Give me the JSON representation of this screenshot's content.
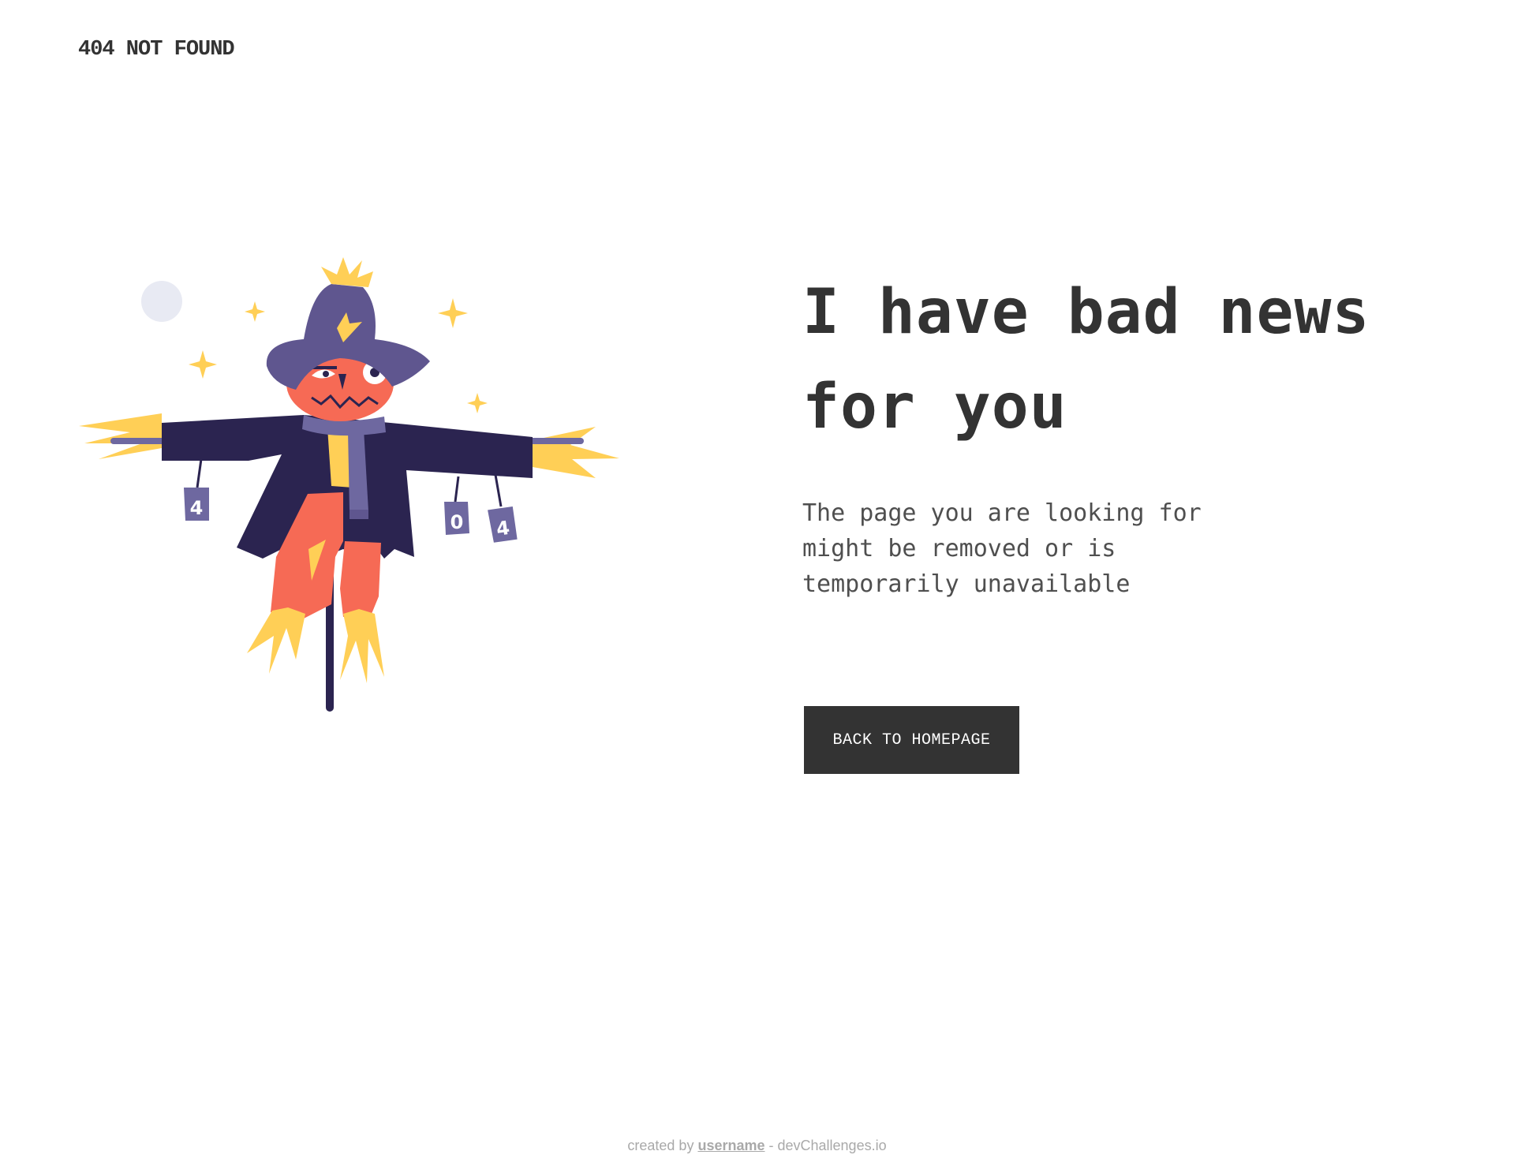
{
  "header": {
    "brand": "404 NOT FOUND"
  },
  "illustration": {
    "can_labels": [
      "4",
      "0",
      "4"
    ]
  },
  "main": {
    "headline_line1": "I have bad news",
    "headline_line2": "for you",
    "description_line1": "The page you are looking for",
    "description_line2": "might be removed or is",
    "description_line3": "temporarily unavailable",
    "cta_label": "BACK TO HOMEPAGE"
  },
  "footer": {
    "prefix": "created by ",
    "username": "username",
    "suffix": " - devChallenges.io"
  },
  "colors": {
    "text_dark": "#333333",
    "text_body": "#4F4F4F",
    "button_bg": "#333333",
    "button_text": "#FFFFFF",
    "coat": "#2B2450",
    "hat": "#5F568F",
    "face": "#F66A55",
    "straw": "#FFCF56",
    "moon": "#E8EAF3"
  }
}
